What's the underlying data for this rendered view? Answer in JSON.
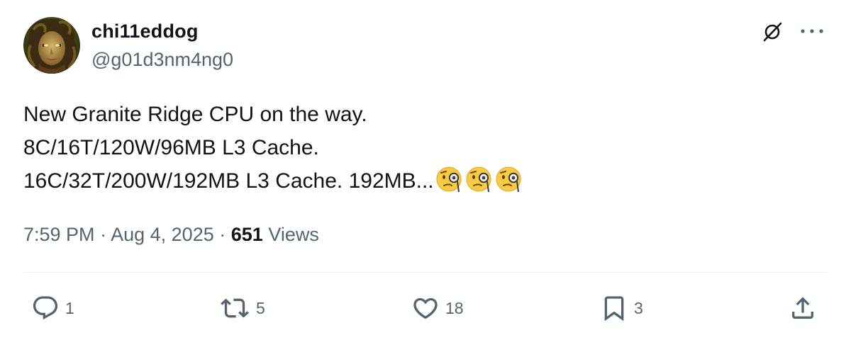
{
  "author": {
    "display_name": "chi11eddog",
    "handle": "@g01d3nm4ng0",
    "avatar_icon": "avatar-illustration"
  },
  "top_icons": {
    "grok_icon": "grok-icon",
    "more_icon": "more-icon"
  },
  "tweet": {
    "lines": [
      "New Granite Ridge CPU on the way.",
      "8C/16T/120W/96MB L3 Cache.",
      "16C/32T/200W/192MB L3 Cache. 192MB..."
    ],
    "emojis": [
      "face-with-monocle",
      "face-with-monocle",
      "face-with-monocle"
    ]
  },
  "meta": {
    "time": "7:59 PM",
    "separator": "·",
    "date": "Aug 4, 2025",
    "views_count": "651",
    "views_label": "Views"
  },
  "actions": {
    "reply": "1",
    "retweet": "5",
    "like": "18",
    "bookmark": "3"
  },
  "colors": {
    "text": "#0f1419",
    "secondary": "#536471",
    "divider": "#eff3f4"
  }
}
